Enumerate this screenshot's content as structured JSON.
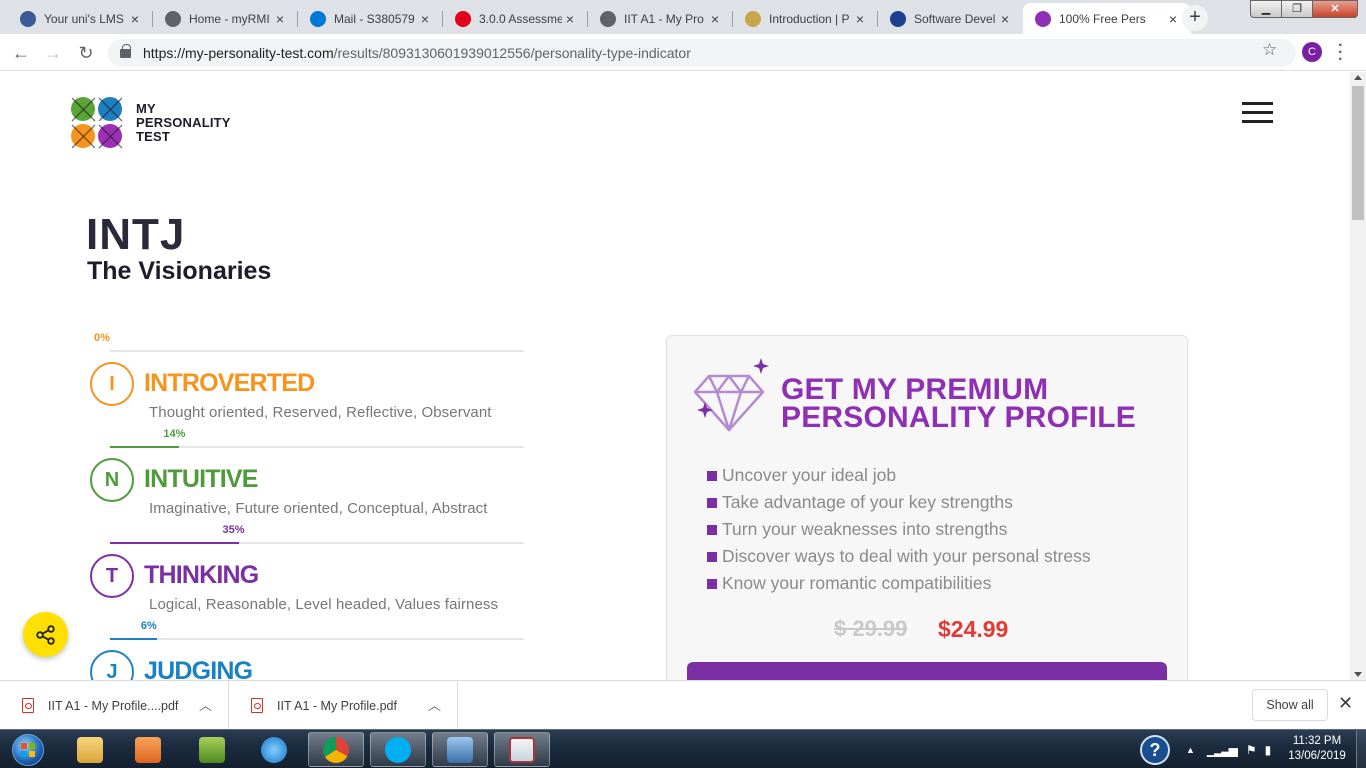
{
  "browser": {
    "tabs": [
      {
        "title": "Your uni's LMS",
        "favicon_color": "#3b5998",
        "close": "×"
      },
      {
        "title": "Home - myRMI",
        "favicon_color": "#5f6368",
        "close": "×"
      },
      {
        "title": "Mail - S380579",
        "favicon_color": "#0078d4",
        "close": "×"
      },
      {
        "title": "3.0.0 Assessme",
        "favicon_color": "#e2001a",
        "close": "×"
      },
      {
        "title": "IIT A1 - My Pro",
        "favicon_color": "#5f6368",
        "close": "×"
      },
      {
        "title": "Introduction | P",
        "favicon_color": "#c7a54a",
        "close": "×"
      },
      {
        "title": "Software Devel",
        "favicon_color": "#1d3f8f",
        "close": "×"
      },
      {
        "title": "100% Free Pers",
        "favicon_color": "#8e2fb4",
        "close": "×"
      }
    ],
    "new_tab": "+",
    "url_host": "https://my-personality-test.com",
    "url_path": "/results/8093130601939012556/personality-type-indicator",
    "profile_initial": "C"
  },
  "page": {
    "logo_lines": [
      "MY",
      "PERSONALITY",
      "TEST"
    ],
    "type_code": "INTJ",
    "type_name": "The Visionaries",
    "traits": [
      {
        "letter": "I",
        "name": "INTROVERTED",
        "percent": "0%",
        "percent_value": 0,
        "description": "Thought oriented, Reserved, Reflective, Observant",
        "color": "#f7941d"
      },
      {
        "letter": "N",
        "name": "INTUITIVE",
        "percent": "14%",
        "percent_value": 14,
        "description": "Imaginative, Future oriented, Conceptual, Abstract",
        "color": "#4f9a3c"
      },
      {
        "letter": "T",
        "name": "THINKING",
        "percent": "35%",
        "percent_value": 35,
        "description": "Logical, Reasonable, Level headed, Values fairness",
        "color": "#7b2fa5"
      },
      {
        "letter": "J",
        "name": "JUDGING",
        "percent": "6%",
        "percent_value": 6,
        "description": "",
        "color": "#1a82c4"
      }
    ],
    "premium": {
      "title_line1": "GET MY PREMIUM",
      "title_line2": "PERSONALITY PROFILE",
      "features": [
        "Uncover your ideal job",
        "Take advantage of your key strengths",
        "Turn your weaknesses into strengths",
        "Discover ways to deal with your personal stress",
        "Know your romantic compatibilities"
      ],
      "old_price": "$ 29.99",
      "new_price": "$24.99"
    }
  },
  "downloads": {
    "items": [
      {
        "filename": "IIT A1 - My Profile....pdf"
      },
      {
        "filename": "IIT A1 - My Profile.pdf"
      }
    ],
    "show_all": "Show all"
  },
  "taskbar": {
    "time": "11:32 PM",
    "date": "13/06/2019"
  }
}
